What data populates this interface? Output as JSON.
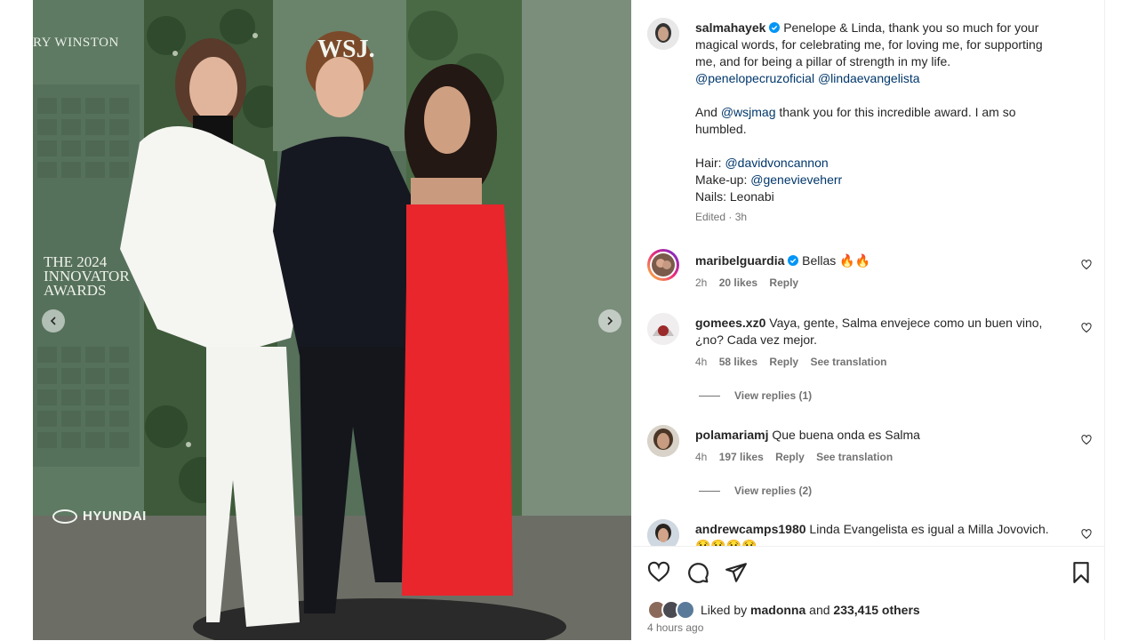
{
  "post": {
    "author": "salmahayek",
    "caption_line1": "Penelope & Linda, thank you so much for your",
    "caption_line2": "magical words, for celebrating me, for loving me, for supporting",
    "caption_line3": "me, and for being a pillar of strength in my life.",
    "mention1": "@penelopecruzoficial",
    "mention2": "@lindaevangelista",
    "and_prefix": "And",
    "mention3": "@wsjmag",
    "thanks_line1": "thank you for this incredible award. I am so",
    "thanks_line2": "humbled.",
    "hair_label": "Hair:",
    "hair_mention": "@davidvoncannon",
    "makeup_label": "Make-up:",
    "makeup_mention": "@genevieveherr",
    "nails": "Nails: Leonabi",
    "edited": "Edited · 3h"
  },
  "photo": {
    "brand_top": "RY WINSTON",
    "awards_line1": "THE 2024",
    "awards_line2": "INNOVATOR",
    "awards_line3": "AWARDS",
    "sponsor": "HYUNDAI",
    "wsj": "WSJ."
  },
  "comments": [
    {
      "user": "maribelguardia",
      "text": "Bellas 🔥🔥",
      "time": "2h",
      "likes": "20 likes",
      "reply": "Reply"
    },
    {
      "user": "gomees.xz0",
      "text1": "Vaya, gente, Salma envejece como un buen vino,",
      "text2": "¿no? Cada vez mejor.",
      "time": "4h",
      "likes": "58 likes",
      "reply": "Reply",
      "translate": "See translation",
      "view_replies": "View replies (1)"
    },
    {
      "user": "polamariamj",
      "text": "Que buena onda es Salma",
      "time": "4h",
      "likes": "197 likes",
      "reply": "Reply",
      "translate": "See translation",
      "view_replies": "View replies (2)"
    },
    {
      "user": "andrewcamps1980",
      "text": "Linda Evangelista es igual a Milla Jovovich.",
      "text2": "😢😢😢😢"
    }
  ],
  "footer": {
    "liked_by": "Liked by",
    "liked_user": "madonna",
    "and": "and",
    "others": "233,415 others",
    "time_ago": "4 hours ago"
  },
  "colors": {
    "verified": "#0095f6",
    "mention": "#00376b",
    "muted": "#737373"
  }
}
